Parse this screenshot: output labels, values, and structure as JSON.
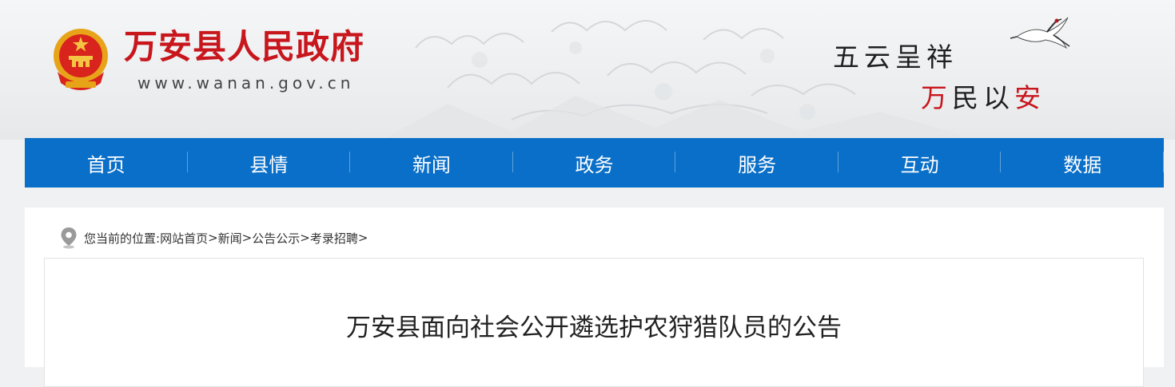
{
  "header": {
    "site_title": "万安县人民政府",
    "site_url": "www.wanan.gov.cn",
    "slogan_line1": "五云呈祥",
    "slogan_line2_red1": "万",
    "slogan_line2_mid": "民以",
    "slogan_line2_red2": "安",
    "brand_red": "#c8161d"
  },
  "nav": {
    "color": "#0a6fc8",
    "items": [
      {
        "label": "首页"
      },
      {
        "label": "县情"
      },
      {
        "label": "新闻"
      },
      {
        "label": "政务"
      },
      {
        "label": "服务"
      },
      {
        "label": "互动"
      },
      {
        "label": "数据"
      }
    ]
  },
  "breadcrumb": {
    "prefix": "您当前的位置:",
    "items": [
      "网站首页",
      "新闻",
      "公告公示",
      "考录招聘"
    ],
    "separator": ">"
  },
  "article": {
    "title": "万安县面向社会公开遴选护农狩猎队员的公告"
  }
}
